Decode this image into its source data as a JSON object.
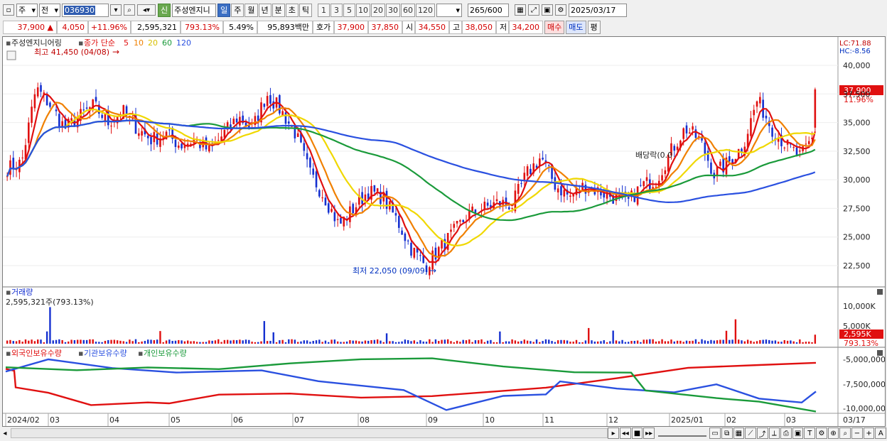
{
  "toolbar": {
    "period_select": "주",
    "market_label": "전",
    "stock_code": "036930",
    "badge_new": "신",
    "stock_name": "주성엔지니",
    "periods": [
      "일",
      "주",
      "월",
      "년",
      "분",
      "초",
      "틱"
    ],
    "active_period": "일",
    "intervals": [
      "1",
      "3",
      "5",
      "10",
      "20",
      "30",
      "60",
      "120"
    ],
    "count": "265",
    "count_max": "/600",
    "date": "2025/03/17"
  },
  "quote": {
    "price": "37,900",
    "change": "4,050",
    "change_pct": "+11.96%",
    "volume": "2,595,321",
    "vol_ratio": "793.13%",
    "turnover": "5.49%",
    "amount": "95,893백만",
    "ask_label": "호가",
    "ask": "37,900",
    "bid": "37,850",
    "open_label": "시",
    "open": "34,550",
    "high_label": "고",
    "high": "38,050",
    "low_label": "저",
    "low": "34,200",
    "buy_label": "매수",
    "sell_label": "매도",
    "avg_label": "평"
  },
  "colors": {
    "up": "#e01010",
    "down": "#1530d0",
    "ma5": "#e01010",
    "ma10": "#f08000",
    "ma20": "#f0d800",
    "ma60": "#1a9a3a",
    "ma120": "#2a50e0",
    "foreign": "#e01010",
    "inst": "#2a50e0",
    "indiv": "#1a9a3a"
  },
  "price_panel": {
    "title": "주성엔지니어링",
    "ma_label": "종가 단순",
    "ma_periods": [
      "5",
      "10",
      "20",
      "60",
      "120"
    ],
    "max_annotation": "최고 41,450 (04/08)",
    "min_annotation": "최저 22,050 (09/09)",
    "div_annotation": "배당락(0.0",
    "lc_label": "LC:71.88",
    "hc_label": "HC:-8.56",
    "price_tag": "37,900",
    "pct_tag": "11.96%",
    "y_ticks": [
      "40,000",
      "37,500",
      "35,000",
      "32,500",
      "30,000",
      "27,500",
      "25,000",
      "22,500"
    ]
  },
  "volume_panel": {
    "title": "거래량",
    "value_label": "2,595,321주(793.13%)",
    "y_ticks": [
      "10,000K",
      "5,000K"
    ],
    "tag": "2,595K",
    "tag2": "793.13%"
  },
  "holding_panel": {
    "legend": [
      "외국인보유수량",
      "기관보유수량",
      "개인보유수량"
    ],
    "y_ticks": [
      "-5,000,000",
      "-7,500,000",
      "-10,000,000"
    ]
  },
  "x_axis": {
    "labels": [
      "2024/02",
      "03",
      "04",
      "05",
      "06",
      "07",
      "08",
      "09",
      "10",
      "11",
      "12",
      "2025/01",
      "02",
      "03"
    ],
    "right_label": "03/17"
  },
  "chart_data": {
    "type": "candlestick",
    "x_range": [
      "2024/02",
      "2025/03/17"
    ],
    "price_ylim": [
      21000,
      42000
    ],
    "max": {
      "value": 41450,
      "date": "04/08"
    },
    "min": {
      "value": 22050,
      "date": "09/09"
    },
    "last": {
      "close": 37900,
      "open": 34550,
      "high": 38050,
      "low": 34200,
      "volume": 2595321
    },
    "close_series": [
      31000,
      31500,
      38000,
      36500,
      34500,
      35500,
      36500,
      35000,
      36000,
      34500,
      33500,
      34000,
      33000,
      33500,
      32500,
      34000,
      35500,
      34500,
      37500,
      36000,
      34000,
      30500,
      28500,
      26000,
      27500,
      29000,
      28500,
      26500,
      24000,
      22500,
      24000,
      25500,
      27000,
      27500,
      28000,
      27800,
      30500,
      32000,
      29500,
      28500,
      29500,
      29000,
      28500,
      28000,
      29500,
      30000,
      32500,
      34500,
      33500,
      30500,
      31500,
      33000,
      37000,
      34500,
      33000,
      32000,
      34000
    ]
  }
}
